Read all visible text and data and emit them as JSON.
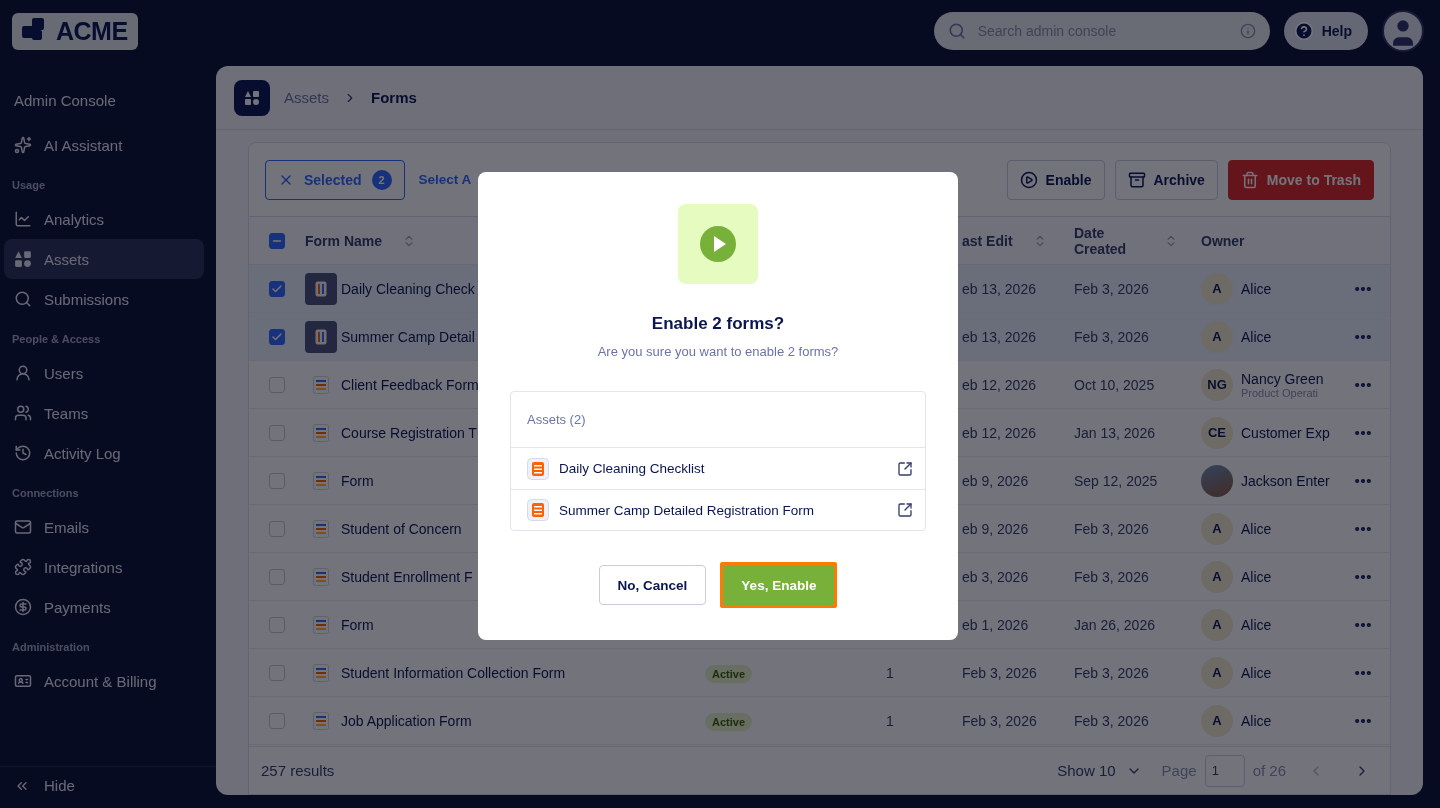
{
  "logo": {
    "text": "ACME"
  },
  "header": {
    "search_placeholder": "Search admin console",
    "help_label": "Help"
  },
  "sidebar": {
    "title": "Admin Console",
    "sections": [
      {
        "items": [
          {
            "label": "AI Assistant",
            "selected": false
          }
        ]
      },
      {
        "heading": "Usage",
        "items": [
          {
            "label": "Analytics",
            "selected": false
          },
          {
            "label": "Assets",
            "selected": true
          },
          {
            "label": "Submissions",
            "selected": false
          }
        ]
      },
      {
        "heading": "People & Access",
        "items": [
          {
            "label": "Users",
            "selected": false
          },
          {
            "label": "Teams",
            "selected": false
          },
          {
            "label": "Activity Log",
            "selected": false
          }
        ]
      },
      {
        "heading": "Connections",
        "items": [
          {
            "label": "Emails",
            "selected": false
          },
          {
            "label": "Integrations",
            "selected": false
          },
          {
            "label": "Payments",
            "selected": false
          }
        ]
      },
      {
        "heading": "Administration",
        "items": [
          {
            "label": "Account & Billing",
            "selected": false
          }
        ]
      }
    ],
    "hide_label": "Hide"
  },
  "breadcrumb": [
    "Assets",
    "Forms"
  ],
  "toolbar": {
    "selected_label": "Selected",
    "selected_count": "2",
    "select_all": "Select A",
    "actions": [
      {
        "label": "Enable",
        "kind": "enable"
      },
      {
        "label": "Archive",
        "kind": "archive"
      },
      {
        "label": "Move to Trash",
        "kind": "trash"
      }
    ]
  },
  "table": {
    "header": {
      "indeterminate": true,
      "form_name": "Form Name",
      "last_edit": "ast Edit",
      "date_created": "Date Created",
      "owner": "Owner"
    },
    "rows": [
      {
        "name": "Daily Cleaning Check",
        "checked": true,
        "last_edit": "eb 13, 2026",
        "date_created": "Feb 3, 2026",
        "owner": {
          "kind": "initials",
          "initials": "A",
          "name": "Alice"
        }
      },
      {
        "name": "Summer Camp Detail",
        "checked": true,
        "last_edit": "eb 13, 2026",
        "date_created": "Feb 3, 2026",
        "owner": {
          "kind": "initials",
          "initials": "A",
          "name": "Alice"
        }
      },
      {
        "name": "Client Feedback Form",
        "checked": false,
        "last_edit": "eb 12, 2026",
        "date_created": "Oct 10, 2025",
        "owner": {
          "kind": "initials",
          "initials": "NG",
          "name": "Nancy Green",
          "subtitle": "Product Operati"
        }
      },
      {
        "name": "Course Registration T",
        "checked": false,
        "last_edit": "eb 12, 2026",
        "date_created": "Jan 13, 2026",
        "owner": {
          "kind": "initials",
          "initials": "CE",
          "name": "Customer Exp"
        }
      },
      {
        "name": "Form",
        "checked": false,
        "last_edit": "eb 9, 2026",
        "date_created": "Sep 12, 2025",
        "owner": {
          "kind": "photo",
          "name": "Jackson Enter"
        }
      },
      {
        "name": "Student of Concern",
        "checked": false,
        "last_edit": "eb 9, 2026",
        "date_created": "Feb 3, 2026",
        "owner": {
          "kind": "initials",
          "initials": "A",
          "name": "Alice"
        }
      },
      {
        "name": "Student Enrollment F",
        "checked": false,
        "last_edit": "eb 3, 2026",
        "date_created": "Feb 3, 2026",
        "owner": {
          "kind": "initials",
          "initials": "A",
          "name": "Alice"
        }
      },
      {
        "name": "Form",
        "checked": false,
        "last_edit": "eb 1, 2026",
        "date_created": "Jan 26, 2026",
        "owner": {
          "kind": "initials",
          "initials": "A",
          "name": "Alice"
        }
      },
      {
        "name": "Student Information Collection Form",
        "checked": false,
        "status": "Active",
        "count": "1",
        "last_edit": "Feb 3, 2026",
        "date_created": "Feb 3, 2026",
        "owner": {
          "kind": "initials",
          "initials": "A",
          "name": "Alice"
        }
      },
      {
        "name": "Job Application Form",
        "checked": false,
        "status": "Active",
        "count": "1",
        "last_edit": "Feb 3, 2026",
        "date_created": "Feb 3, 2026",
        "owner": {
          "kind": "initials",
          "initials": "A",
          "name": "Alice"
        }
      }
    ]
  },
  "footer": {
    "results": "257 results",
    "show": "Show 10",
    "page_label": "Page",
    "page_value": "1",
    "page_of": "of 26"
  },
  "modal": {
    "title": "Enable 2 forms?",
    "message": "Are you sure you want to enable 2 forms?",
    "list_title": "Assets (2)",
    "items": [
      "Daily Cleaning Checklist",
      "Summer Camp Detailed Registration Form"
    ],
    "cancel": "No, Cancel",
    "confirm": "Yes, Enable",
    "confirm_focused": true
  }
}
